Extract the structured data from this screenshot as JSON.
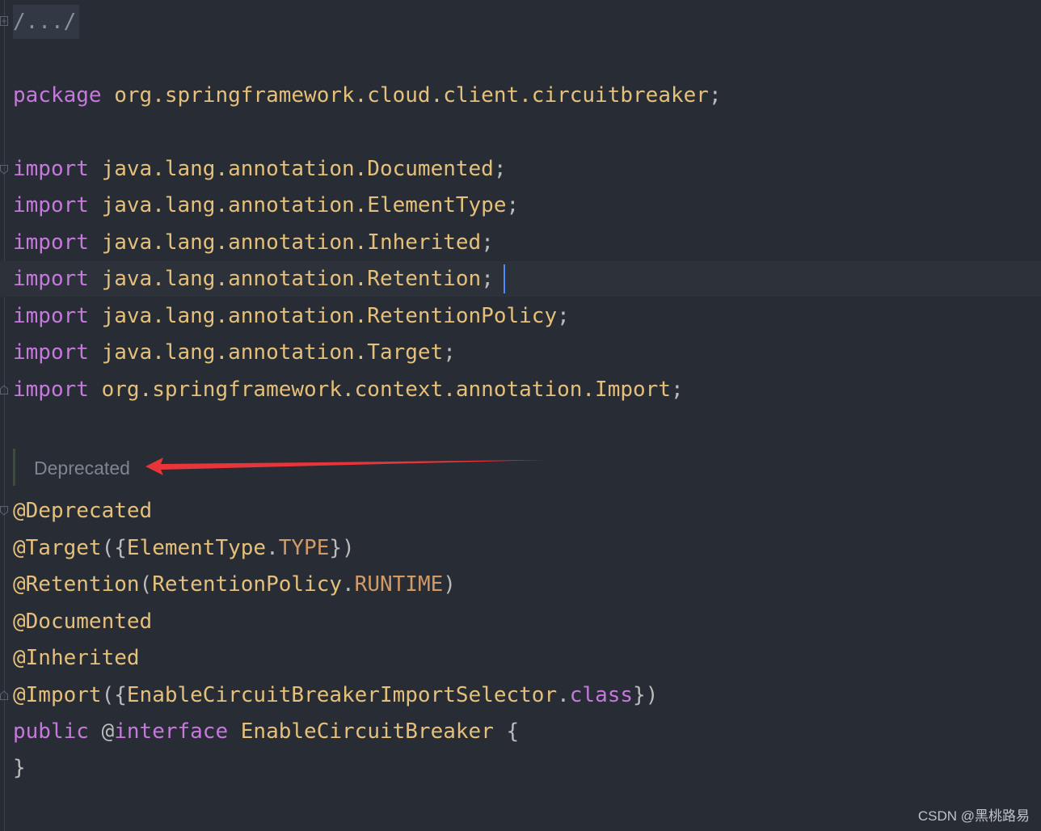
{
  "editor": {
    "collapsed_header": "/.../",
    "package_line": {
      "keyword": "package",
      "name": "org.springframework.cloud.client.circuitbreaker",
      "end": ";"
    },
    "imports": [
      {
        "keyword": "import",
        "name": "java.lang.annotation.Documented",
        "end": ";"
      },
      {
        "keyword": "import",
        "name": "java.lang.annotation.ElementType",
        "end": ";"
      },
      {
        "keyword": "import",
        "name": "java.lang.annotation.Inherited",
        "end": ";"
      },
      {
        "keyword": "import",
        "name": "java.lang.annotation.Retention",
        "end": ";"
      },
      {
        "keyword": "import",
        "name": "java.lang.annotation.RetentionPolicy",
        "end": ";"
      },
      {
        "keyword": "import",
        "name": "java.lang.annotation.Target",
        "end": ";"
      },
      {
        "keyword": "import",
        "name": "org.springframework.context.annotation.Import",
        "end": ";"
      }
    ],
    "inlay_hint": "Deprecated",
    "annotations": {
      "deprecated": "@Deprecated",
      "target_name": "@Target",
      "target_open": "({",
      "target_type": "ElementType",
      "target_dot": ".",
      "target_const": "TYPE",
      "target_close": "})",
      "retention_name": "@Retention",
      "retention_open": "(",
      "retention_type": "RetentionPolicy",
      "retention_dot": ".",
      "retention_const": "RUNTIME",
      "retention_close": ")",
      "documented": "@Documented",
      "inherited": "@Inherited",
      "import_name": "@Import",
      "import_open": "({",
      "import_class": "EnableCircuitBreakerImportSelector",
      "import_dot": ".",
      "import_kw": "class",
      "import_close": "})"
    },
    "declaration": {
      "public": "public",
      "at": "@",
      "interface": "interface",
      "name": "EnableCircuitBreaker",
      "open": "{",
      "close": "}"
    }
  },
  "colors": {
    "background": "#282c34",
    "keyword": "#c678dd",
    "identifier": "#e5c07b",
    "constant": "#d19a66",
    "caret": "#528bff",
    "arrow": "#e8353a"
  },
  "watermark": "CSDN @黑桃路易"
}
